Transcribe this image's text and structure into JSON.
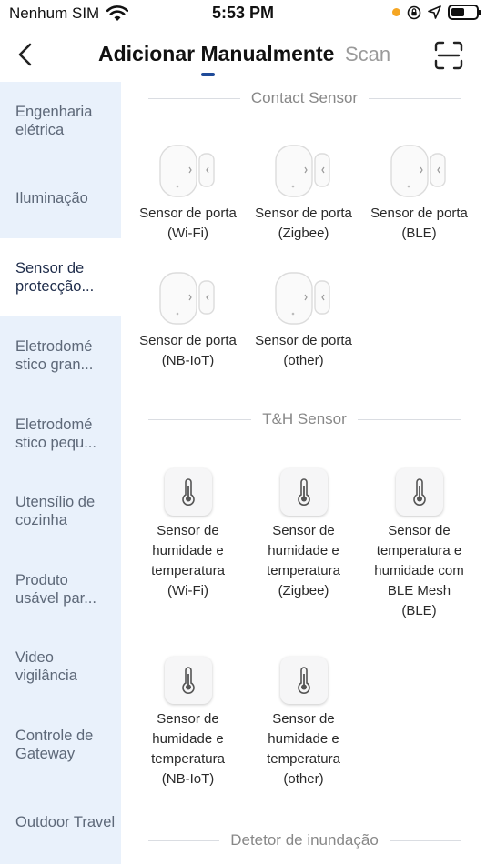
{
  "status_bar": {
    "carrier": "Nenhum SIM",
    "time": "5:53 PM"
  },
  "header": {
    "title": "Adicionar Manualmente",
    "scan_tab": "Scan"
  },
  "sidebar": {
    "items": [
      {
        "label": "Engenharia elétrica"
      },
      {
        "label": "Iluminação"
      },
      {
        "label": "Sensor de protecção..."
      },
      {
        "label": "Eletrodomé stico gran..."
      },
      {
        "label": "Eletrodomé stico pequ..."
      },
      {
        "label": "Utensílio de cozinha"
      },
      {
        "label": "Produto usável par..."
      },
      {
        "label": "Video vigilância"
      },
      {
        "label": "Controle de Gateway"
      },
      {
        "label": "Outdoor Travel"
      }
    ],
    "active_index": 2
  },
  "content": {
    "sections": [
      {
        "title": "Contact Sensor",
        "products": [
          {
            "name_line1": "Sensor de porta",
            "name_line2": "(Wi-Fi)",
            "icon": "door-sensor-icon"
          },
          {
            "name_line1": "Sensor de porta",
            "name_line2": "(Zigbee)",
            "icon": "door-sensor-icon"
          },
          {
            "name_line1": "Sensor de porta",
            "name_line2": "(BLE)",
            "icon": "door-sensor-icon"
          },
          {
            "name_line1": "Sensor de porta",
            "name_line2": "(NB-IoT)",
            "icon": "door-sensor-icon"
          },
          {
            "name_line1": "Sensor de porta",
            "name_line2": "(other)",
            "icon": "door-sensor-icon"
          }
        ]
      },
      {
        "title": "T&H Sensor",
        "products": [
          {
            "lines": [
              "Sensor de",
              "humidade e",
              "temperatura",
              "(Wi-Fi)"
            ],
            "icon": "thermometer-icon"
          },
          {
            "lines": [
              "Sensor de",
              "humidade e",
              "temperatura",
              "(Zigbee)"
            ],
            "icon": "thermometer-icon"
          },
          {
            "lines": [
              "Sensor de",
              "temperatura e",
              "humidade com",
              "BLE Mesh",
              "(BLE)"
            ],
            "icon": "thermometer-icon"
          },
          {
            "lines": [
              "Sensor de",
              "humidade e",
              "temperatura",
              "(NB-IoT)"
            ],
            "icon": "thermometer-icon"
          },
          {
            "lines": [
              "Sensor de",
              "humidade e",
              "temperatura",
              "(other)"
            ],
            "icon": "thermometer-icon"
          }
        ]
      },
      {
        "title": "Detetor de inundação",
        "products": []
      }
    ]
  },
  "colors": {
    "accent": "#1f4b99",
    "sidebar_bg": "#e9f1fb",
    "sidebar_active_bg": "#ffffff"
  }
}
